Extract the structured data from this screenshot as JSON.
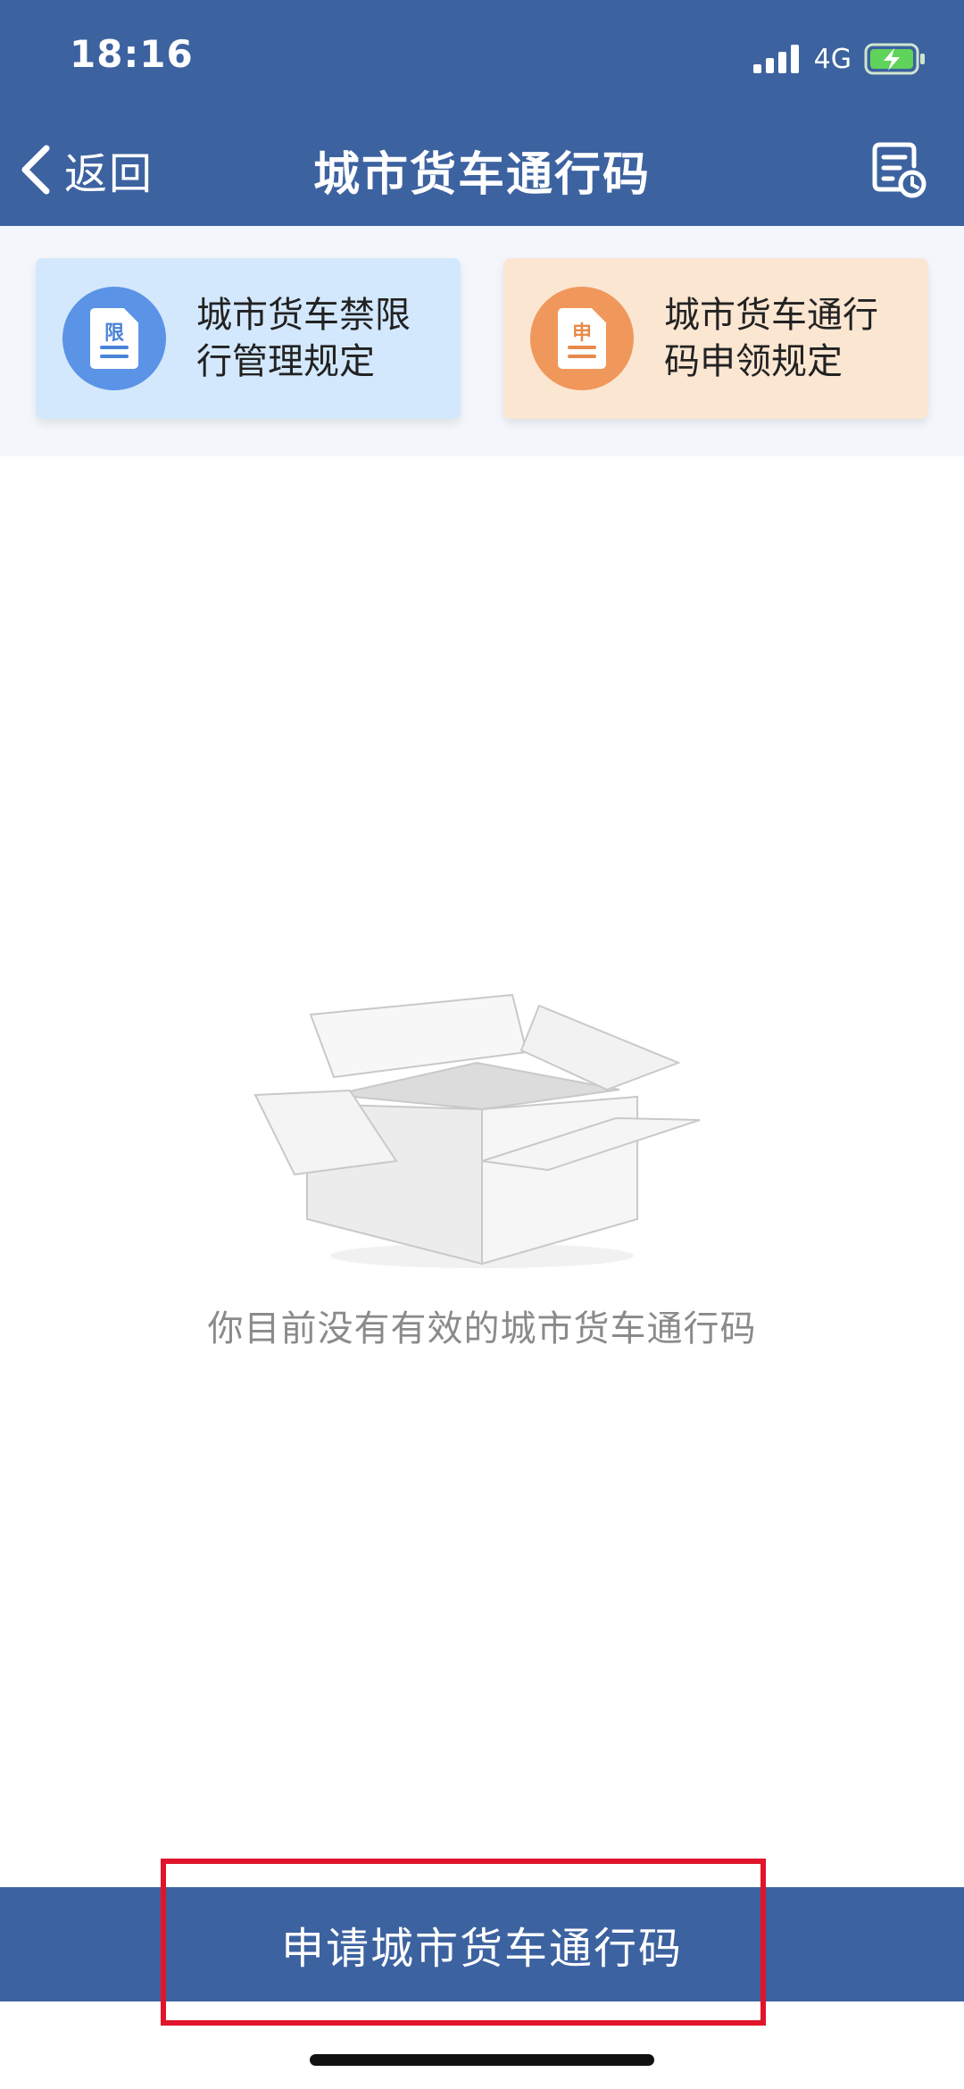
{
  "status_bar": {
    "time": "18:16",
    "network": "4G",
    "icons": [
      "signal-icon",
      "battery-charging-icon"
    ]
  },
  "nav": {
    "back_label": "返回",
    "title": "城市货车通行码",
    "record_icon": "record-clock-icon"
  },
  "cards": [
    {
      "icon_char": "限",
      "label": "城市货车禁限行管理规定",
      "color": "#5b93e6"
    },
    {
      "icon_char": "申",
      "label": "城市货车通行码申领规定",
      "color": "#f0985c"
    }
  ],
  "empty_state": {
    "icon": "empty-box-icon",
    "message": "你目前没有有效的城市货车通行码"
  },
  "apply_button": {
    "label": "申请城市货车通行码"
  },
  "colors": {
    "header": "#3d62a0",
    "highlight": "#e0152b"
  }
}
